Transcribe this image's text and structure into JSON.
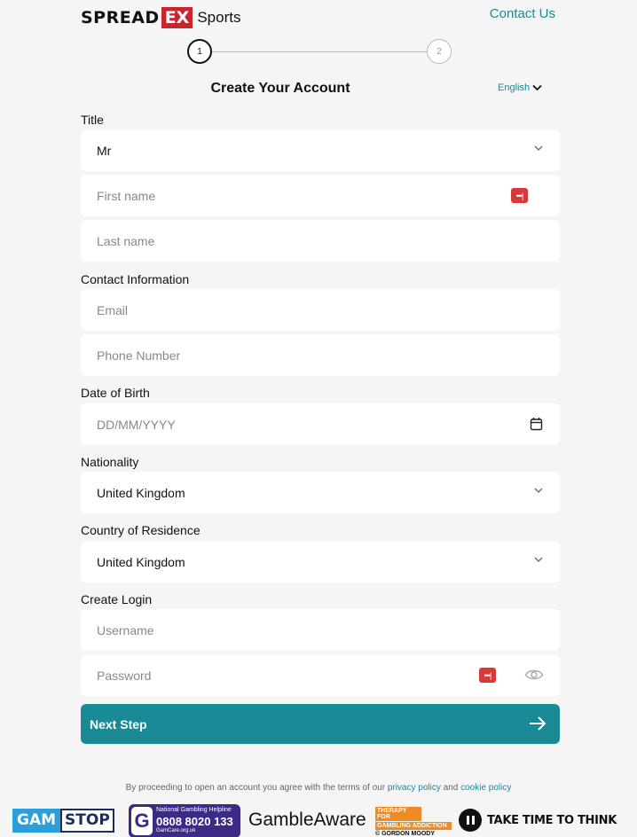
{
  "header": {
    "logo": {
      "spread": "SPREAD",
      "ex": "EX",
      "sports": "Sports"
    },
    "contact_link": "Contact Us"
  },
  "stepper": {
    "step1": "1",
    "step2": "2",
    "current_step": 1
  },
  "form": {
    "title": "Create Your Account",
    "language": "English",
    "sections": {
      "title": "Title",
      "contact": "Contact Information",
      "dob": "Date of Birth",
      "nationality": "Nationality",
      "residence": "Country of Residence",
      "login": "Create Login"
    },
    "fields": {
      "title_value": "Mr",
      "first_name_placeholder": "First name",
      "last_name_placeholder": "Last name",
      "email_placeholder": "Email",
      "phone_placeholder": "Phone Number",
      "dob_placeholder": "DD/MM/YYYY",
      "nationality_value": "United Kingdom",
      "residence_value": "United Kingdom",
      "username_placeholder": "Username",
      "password_placeholder": "Password"
    },
    "password_manager_icon": "•••|",
    "next_button": "Next Step"
  },
  "terms": {
    "prefix": "By proceeding to open an account you agree with the terms of our",
    "privacy": "privacy policy",
    "and": "and",
    "cookie": "cookie policy"
  },
  "footer": {
    "gamstop": {
      "gam": "GAM",
      "stop": "STOP"
    },
    "helpline": {
      "g": "G",
      "line1": "National Gambling Helpline",
      "number": "0808 8020 133",
      "site": "GamCare.org.uk"
    },
    "gambleaware": {
      "gamble": "Gamble",
      "aware": "Aware"
    },
    "gordon_moody": {
      "line1": "THERAPY FOR",
      "line2": "GAMBLING ADDICTION",
      "line3": "© GORDON MOODY"
    },
    "take_time": "TAKE TIME TO THINK"
  },
  "colors": {
    "accent": "#1a8a96",
    "brand_red": "#c8252c",
    "link": "#1a8a9a"
  }
}
